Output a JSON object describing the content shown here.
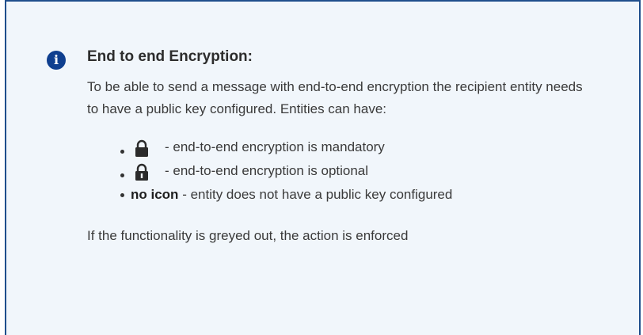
{
  "info": {
    "title": "End to end Encryption:",
    "description": "To be able to send a message with end-to-end encryption the recipient entity needs to have a public key configured. Entities can have:",
    "items": [
      {
        "icon": "lock-closed-icon",
        "text": "- end-to-end encryption is mandatory"
      },
      {
        "icon": "lock-open-icon",
        "text": "- end-to-end encryption is optional"
      },
      {
        "bold_label": "no icon",
        "text": "- entity does not have a public key configured"
      }
    ],
    "footer": "If the functionality is greyed out, the action is enforced"
  },
  "colors": {
    "panel_background": "#f1f6fb",
    "border": "#1f4e8c",
    "info_icon": "#0f3f8f",
    "text": "#3a3a3a"
  }
}
